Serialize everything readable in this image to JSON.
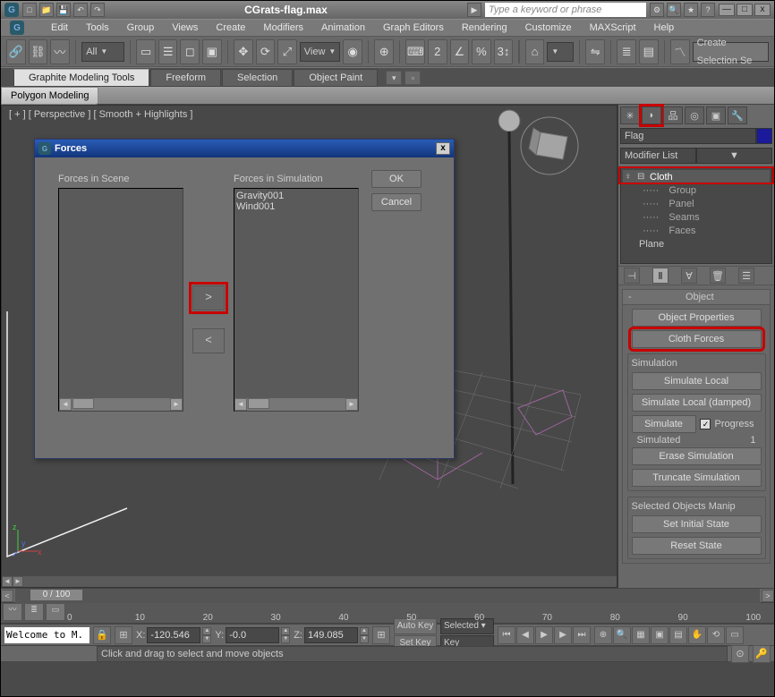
{
  "title": "CGrats-flag.max",
  "search_placeholder": "Type a keyword or phrase",
  "menubar": [
    "Edit",
    "Tools",
    "Group",
    "Views",
    "Create",
    "Modifiers",
    "Animation",
    "Graph Editors",
    "Rendering",
    "Customize",
    "MAXScript",
    "Help"
  ],
  "toolbar": {
    "selfilter": "All",
    "viewlabel": "View",
    "create_sel": "Create Selection Se"
  },
  "ribbon_tabs": [
    "Graphite Modeling Tools",
    "Freeform",
    "Selection",
    "Object Paint"
  ],
  "subrib_tab": "Polygon Modeling",
  "viewport_label": "[ + ] [ Perspective ] [ Smooth + Highlights ]",
  "dialog": {
    "title": "Forces",
    "scene_label": "Forces in Scene",
    "sim_label": "Forces in Simulation",
    "scene_items": [],
    "sim_items": [
      "Gravity001",
      "Wind001"
    ],
    "add_btn": ">",
    "remove_btn": "<",
    "ok": "OK",
    "cancel": "Cancel"
  },
  "cmd": {
    "obj_name": "Flag",
    "modlist_label": "Modifier List",
    "stack": {
      "cloth": "Cloth",
      "sub": [
        "Group",
        "Panel",
        "Seams",
        "Faces"
      ],
      "base": "Plane"
    },
    "rollout_title": "Object",
    "obj_props": "Object Properties",
    "cloth_forces": "Cloth Forces",
    "sim_hdr": "Simulation",
    "sim_local": "Simulate Local",
    "sim_local_d": "Simulate Local (damped)",
    "simulate": "Simulate",
    "progress_lbl": "Progress",
    "simulated_lbl": "Simulated",
    "simulated_val": "1",
    "erase": "Erase Simulation",
    "truncate": "Truncate Simulation",
    "sel_obj_manip": "Selected Objects Manip",
    "set_initial": "Set Initial State",
    "reset_state": "Reset State"
  },
  "timeslider": {
    "frame_label": "0 / 100"
  },
  "ruler_ticks": [
    "0",
    "10",
    "20",
    "30",
    "40",
    "50",
    "60",
    "70",
    "80",
    "90",
    "100"
  ],
  "status": {
    "welcome": "Welcome to M.",
    "prompt": "Click and drag to select and move objects",
    "x": "-120.546",
    "y": "-0.0",
    "z": "149.085",
    "autokey": "Auto Key",
    "setkey": "Set Key",
    "selected": "Selected",
    "keyfilters": "Key Filters..."
  }
}
